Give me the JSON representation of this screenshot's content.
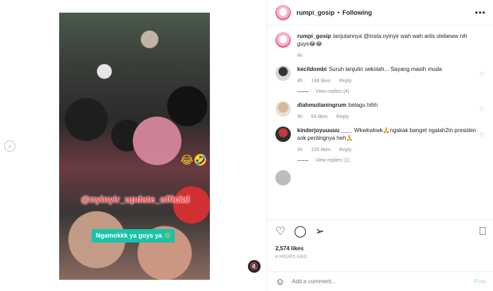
{
  "post": {
    "username": "rumpi_gosip",
    "separator": "•",
    "follow_status": "Following",
    "more_label": "•••"
  },
  "media": {
    "overlay_handle": "@nyinyir_update_official",
    "overlay_caption": "Ngamokkk ya guys ya",
    "caption_emoji": "😩",
    "emoji_mark": "😂🤣",
    "prev_icon": "‹",
    "mute_icon": "🔇"
  },
  "caption": {
    "username": "rumpi_gosip",
    "text": "lanjutannya @insta.nyinyir wah wah artis slebeww nih guys😂😂",
    "time": "4h"
  },
  "comments": [
    {
      "username": "kecildombi",
      "text": "Suruh lanjutin sekolah... Sayang masih muda",
      "time": "4h",
      "likes": "188 likes",
      "reply": "Reply",
      "view_replies": "View replies (4)"
    },
    {
      "username": "diahmutianingrum",
      "text": "belagu hihh",
      "time": "4h",
      "likes": "66 likes",
      "reply": "Reply"
    },
    {
      "username": "kinderjoyuuuuu____",
      "text": "Wkwkwkwk🙏ngakak banget ngalah2in presiden sok pentingnya heh🙏",
      "time": "4h",
      "likes": "105 likes",
      "reply": "Reply",
      "view_replies": "View replies (1)"
    }
  ],
  "actions": {
    "likes": "2,574 likes",
    "time_ago": "4 HOURS AGO"
  },
  "add_comment": {
    "placeholder": "Add a comment...",
    "post_label": "Post"
  },
  "icons": {
    "heart": "heart-icon",
    "comment": "comment-icon",
    "share": "share-icon",
    "save": "bookmark-icon",
    "emoji": "emoji-icon"
  }
}
